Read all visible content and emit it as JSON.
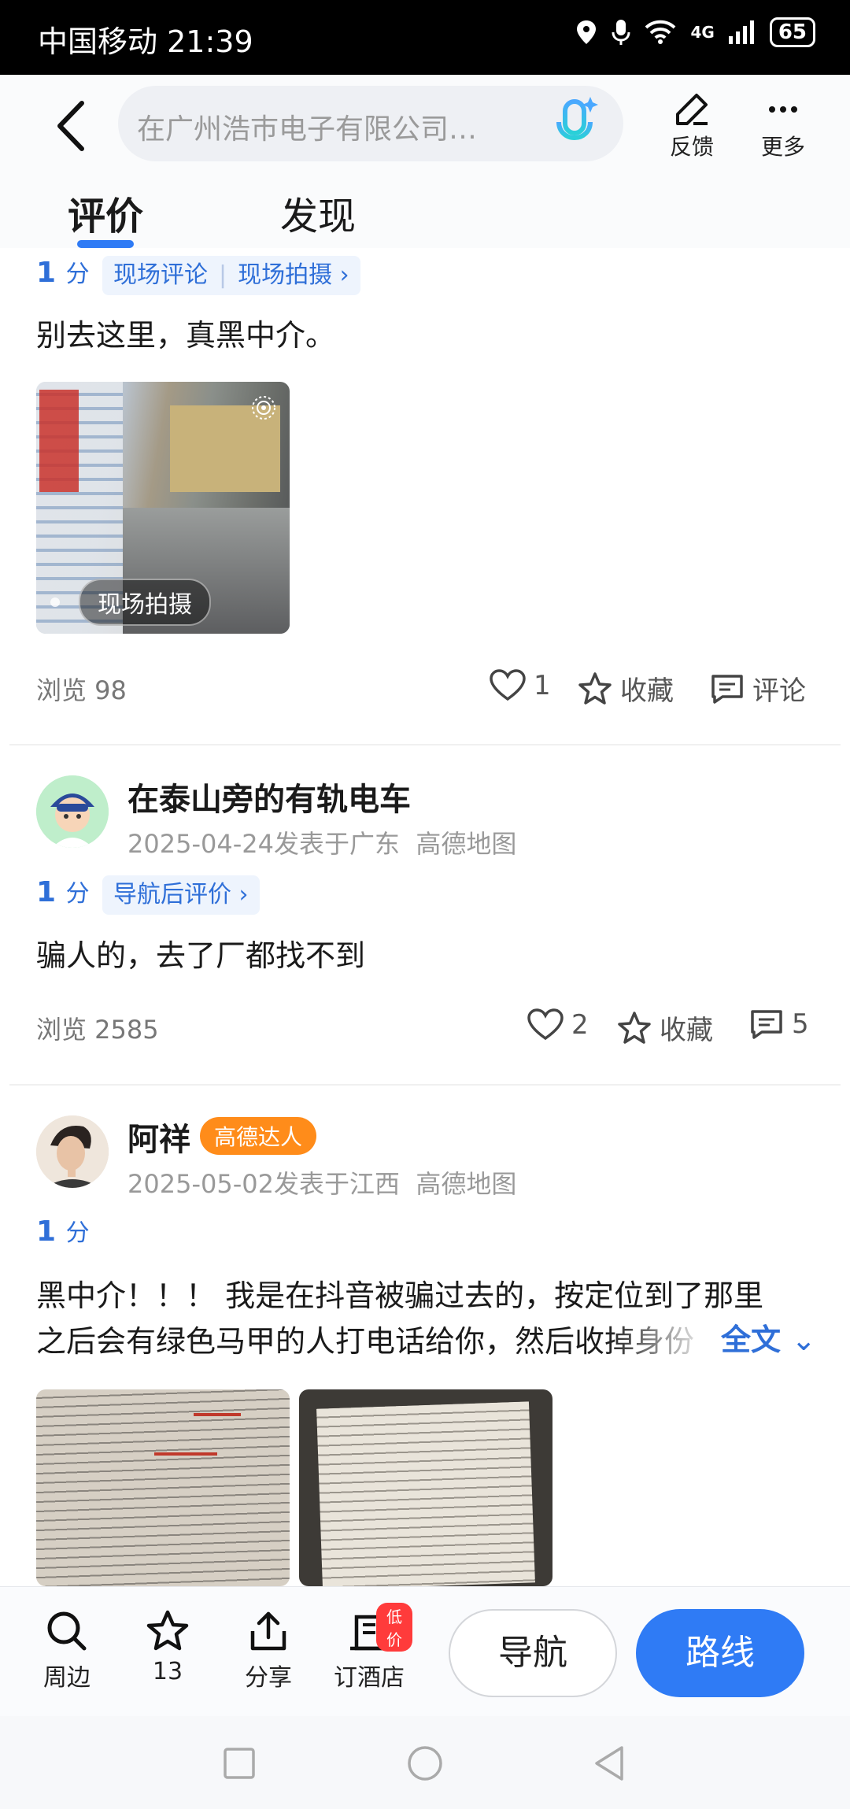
{
  "status_bar": {
    "carrier": "中国移动",
    "time": "21:39",
    "network": "4G",
    "battery": "65"
  },
  "header": {
    "search_placeholder": "在广州浩巿电子有限公司…",
    "feedback_label": "反馈",
    "more_label": "更多"
  },
  "tabs": [
    {
      "label": "评价"
    },
    {
      "label": "发现"
    }
  ],
  "review1": {
    "score": "1",
    "score_unit": "分",
    "tag1": "现场评论",
    "tag2": "现场拍摄",
    "text": "别去这里，真黑中介。",
    "photo_chip": "现场拍摄",
    "views": "浏览 98",
    "likes": "1",
    "collect": "收藏",
    "comment": "评论"
  },
  "review2": {
    "username": "在泰山旁的有轨电车",
    "date": "2025-04-24发表于广东",
    "source": "高德地图",
    "score": "1",
    "score_unit": "分",
    "tag": "导航后评价",
    "text": "骗人的，去了厂都找不到",
    "views": "浏览 2585",
    "likes": "2",
    "collect": "收藏",
    "comments": "5"
  },
  "review3": {
    "username": "阿祥",
    "badge": "高德达人",
    "date": "2025-05-02发表于江西",
    "source": "高德地图",
    "score": "1",
    "score_unit": "分",
    "text_line1": "黑中介！！！ 我是在抖音被骗过去的，按定位到了那里",
    "text_line2": "之后会有绿色马甲的人打电话给你，然后收掉身份",
    "expand": "全文"
  },
  "bottom_bar": {
    "nearby": "周边",
    "favorites_count": "13",
    "share": "分享",
    "hotel": "订酒店",
    "hotel_badge": "低价",
    "navigate": "导航",
    "route": "路线"
  }
}
